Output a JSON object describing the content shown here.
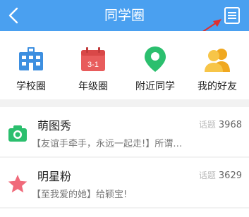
{
  "header": {
    "title": "同学圈",
    "bg_color": "#4aa0f0"
  },
  "categories": [
    {
      "label": "学校圈",
      "icon": "school-icon",
      "color": "#3d8fe0"
    },
    {
      "label": "年级圈",
      "icon": "calendar-icon",
      "color": "#e85c5c",
      "badge": "3-1"
    },
    {
      "label": "附近同学",
      "icon": "location-pin-icon",
      "color": "#2bbf6e"
    },
    {
      "label": "我的好友",
      "icon": "friends-icon",
      "color": "#f5b82e"
    }
  ],
  "groups": [
    {
      "name": "萌图秀",
      "desc": "【友谊手牵手，永远一起走!】所谓…",
      "topic_label": "话题",
      "topic_count": "3968",
      "icon": "camera-icon",
      "icon_color": "#2bbf6e"
    },
    {
      "name": "明星粉",
      "desc": "【至我爱的她】给颖宝!",
      "topic_label": "话题",
      "topic_count": "3629",
      "icon": "star-icon",
      "icon_color": "#f06a7a"
    }
  ]
}
